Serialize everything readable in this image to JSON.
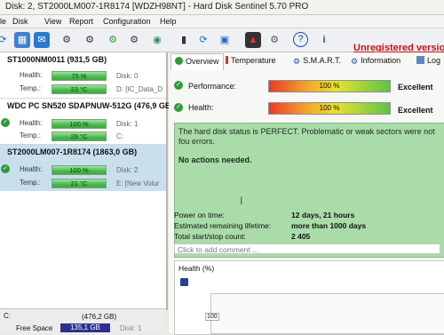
{
  "window": {
    "title": "Disk: 2, ST2000LM007-1R8174 [WDZH98NT]  -  Hard Disk Sentinel 5.70 PRO"
  },
  "menu": [
    "le",
    "Disk",
    "View",
    "Report",
    "Configuration",
    "Help"
  ],
  "notice": {
    "text": "Unregistered version, p",
    "color": "#c41414"
  },
  "disks": [
    {
      "name": "ST1000NM0011 (931,5 GB)",
      "health_label": "Health:",
      "health": "75 %",
      "health_pct": 75,
      "temp_label": "Temp.:",
      "temp": "23 °C",
      "disk_id": "Disk: 0",
      "volume": "D: [IC_Data_D"
    },
    {
      "name": "WDC PC SN520 SDAPNUW-512G (476,9 GB)",
      "health_label": "Health:",
      "health": "100 %",
      "health_pct": 100,
      "temp_label": "Temp.:",
      "temp": "29 °C",
      "disk_id": "Disk: 1",
      "volume": "C:"
    },
    {
      "name": "ST2000LM007-1R8174 (1863,0 GB)",
      "health_label": "Health:",
      "health": "100 %",
      "health_pct": 100,
      "temp_label": "Temp.:",
      "temp": "21 °C",
      "disk_id": "Disk: 2",
      "volume": "E: [New Volur"
    }
  ],
  "volume_panel": {
    "drive": "C:",
    "size": "(476,2 GB)",
    "free_label": "Free Space",
    "free": "135,1 GB",
    "disk": "Disk: 1"
  },
  "tabs": [
    "Overview",
    "Temperature",
    "S.M.A.R.T.",
    "Information",
    "Log"
  ],
  "metrics": [
    {
      "label": "Performance:",
      "value": "100 %",
      "rating": "Excellent",
      "pct": 100
    },
    {
      "label": "Health:",
      "value": "100 %",
      "rating": "Excellent",
      "pct": 100
    }
  ],
  "status_box": {
    "message": "The hard disk status is PERFECT. Problematic or weak sectors were not fou errors.",
    "actions": "No actions needed.",
    "color": "#a9dca9"
  },
  "info": [
    {
      "label": "Power on time:",
      "value": "12 days, 21 hours"
    },
    {
      "label": "Estimated remaining lifetime:",
      "value": "more than 1000 days"
    },
    {
      "label": "Total start/stop count:",
      "value": "2 405"
    }
  ],
  "comment_placeholder": "Click to add comment ...",
  "health_chart": {
    "title": "Health (%)",
    "y_label": "100"
  }
}
